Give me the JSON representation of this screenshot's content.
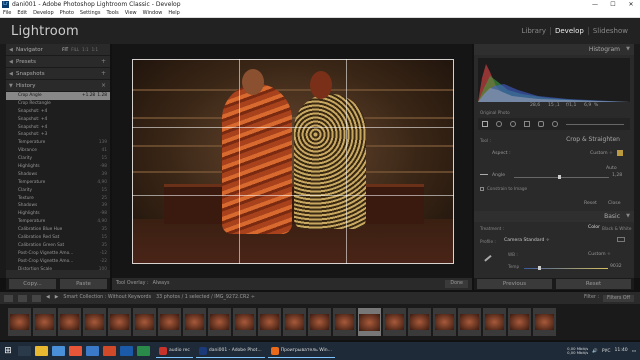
{
  "window": {
    "title": "dani001 - Adobe Photoshop Lightroom Classic - Develop",
    "app_icon_text": "Lr",
    "controls": [
      "—",
      "☐",
      "✕"
    ]
  },
  "menu": [
    "File",
    "Edit",
    "Develop",
    "Photo",
    "Settings",
    "Tools",
    "View",
    "Window",
    "Help"
  ],
  "header": {
    "logo": "Lightroom",
    "modules": [
      "Library",
      "Develop",
      "Slideshow"
    ],
    "active_module": "Develop"
  },
  "left_panel": {
    "navigator": {
      "label": "Navigator",
      "tabs": [
        "FIT",
        "FILL",
        "1:1",
        "1:1"
      ]
    },
    "presets": {
      "label": "Presets"
    },
    "snapshots": {
      "label": "Snapshots"
    },
    "history": {
      "label": "History",
      "items": [
        {
          "label": "Crop Angle",
          "v1": "+1.28",
          "v2": "1.28",
          "selected": true
        },
        {
          "label": "Crop Rectangle",
          "v1": "",
          "v2": ""
        },
        {
          "label": "Snapshot: +4",
          "v1": "",
          "v2": ""
        },
        {
          "label": "Snapshot: +4",
          "v1": "",
          "v2": ""
        },
        {
          "label": "Snapshot: +4",
          "v1": "",
          "v2": ""
        },
        {
          "label": "Snapshot: +3",
          "v1": "",
          "v2": ""
        },
        {
          "label": "Temperature",
          "v1": "",
          "v2": "139"
        },
        {
          "label": "Vibrance",
          "v1": "",
          "v2": "41"
        },
        {
          "label": "Clarity",
          "v1": "",
          "v2": "15"
        },
        {
          "label": "Highlights",
          "v1": "",
          "v2": "-98"
        },
        {
          "label": "Shadows",
          "v1": "",
          "v2": "39"
        },
        {
          "label": "Temperature",
          "v1": "",
          "v2": "4,90"
        },
        {
          "label": "Clarity",
          "v1": "",
          "v2": "15"
        },
        {
          "label": "Texture",
          "v1": "",
          "v2": "25"
        },
        {
          "label": "Shadows",
          "v1": "",
          "v2": "39"
        },
        {
          "label": "Highlights",
          "v1": "",
          "v2": "-98"
        },
        {
          "label": "Temperature",
          "v1": "",
          "v2": "4,90"
        },
        {
          "label": "Calibration Blue Hue",
          "v1": "",
          "v2": "35"
        },
        {
          "label": "Calibration Red Sat",
          "v1": "",
          "v2": "15"
        },
        {
          "label": "Calibration Green Sat",
          "v1": "",
          "v2": "35"
        },
        {
          "label": "Post-Crop Vignette Amo...",
          "v1": "",
          "v2": "-12"
        },
        {
          "label": "Post-Crop Vignette Amo...",
          "v1": "",
          "v2": "-22"
        },
        {
          "label": "Distortion Scale",
          "v1": "",
          "v2": "100"
        }
      ]
    },
    "copy_label": "Copy...",
    "paste_label": "Paste"
  },
  "toolbar": {
    "overlay_label": "Tool Overlay :",
    "overlay_value": "Always",
    "done_label": "Done"
  },
  "right_panel": {
    "histogram_label": "Histogram",
    "exif": [
      "",
      "28,6",
      "15 ,1",
      "f/1,1",
      "6,9",
      "%"
    ],
    "original_photo": "Original Photo",
    "crop_title": "Crop & Straighten",
    "tool_label": "Tool :",
    "aspect_label": "Aspect :",
    "aspect_value": "Custom ÷",
    "auto_label": "Auto",
    "angle_label": "Angle",
    "angle_value": "1,28",
    "constrain_label": "Constrain to Image",
    "reset_label": "Reset",
    "close_label": "Close",
    "basic_label": "Basic",
    "treatment_label": "Treatment :",
    "color_label": "Color",
    "bw_label": "Black & White",
    "profile_label": "Profile :",
    "profile_value": "Camera Standard ÷",
    "wb_label": "WB :",
    "wb_value": "Custom ÷",
    "temp_label": "Temp",
    "temp_value": "9032",
    "previous_label": "Previous",
    "reset_btn_label": "Reset"
  },
  "filmstrip": {
    "info": "Smart Collection : Without Keywords",
    "count": "33 photos / 1 selected / IMG_9272.CR2 ÷",
    "filter_label": "Filter :",
    "filter_value": "Filters Off",
    "thumb_count": 22,
    "selected_index": 14
  },
  "taskbar": {
    "tasks": [
      {
        "label": "audio rec",
        "color": "#c8342c"
      },
      {
        "label": "dani001 - Adobe Phot...",
        "color": "#1a3a7a"
      },
      {
        "label": "Проигрыватель Win...",
        "color": "#e86a1a"
      }
    ],
    "net_up": "0,00 Mbit/s",
    "net_down": "0,00 Mbit/s",
    "lang": "РУС",
    "time": "11:40"
  }
}
